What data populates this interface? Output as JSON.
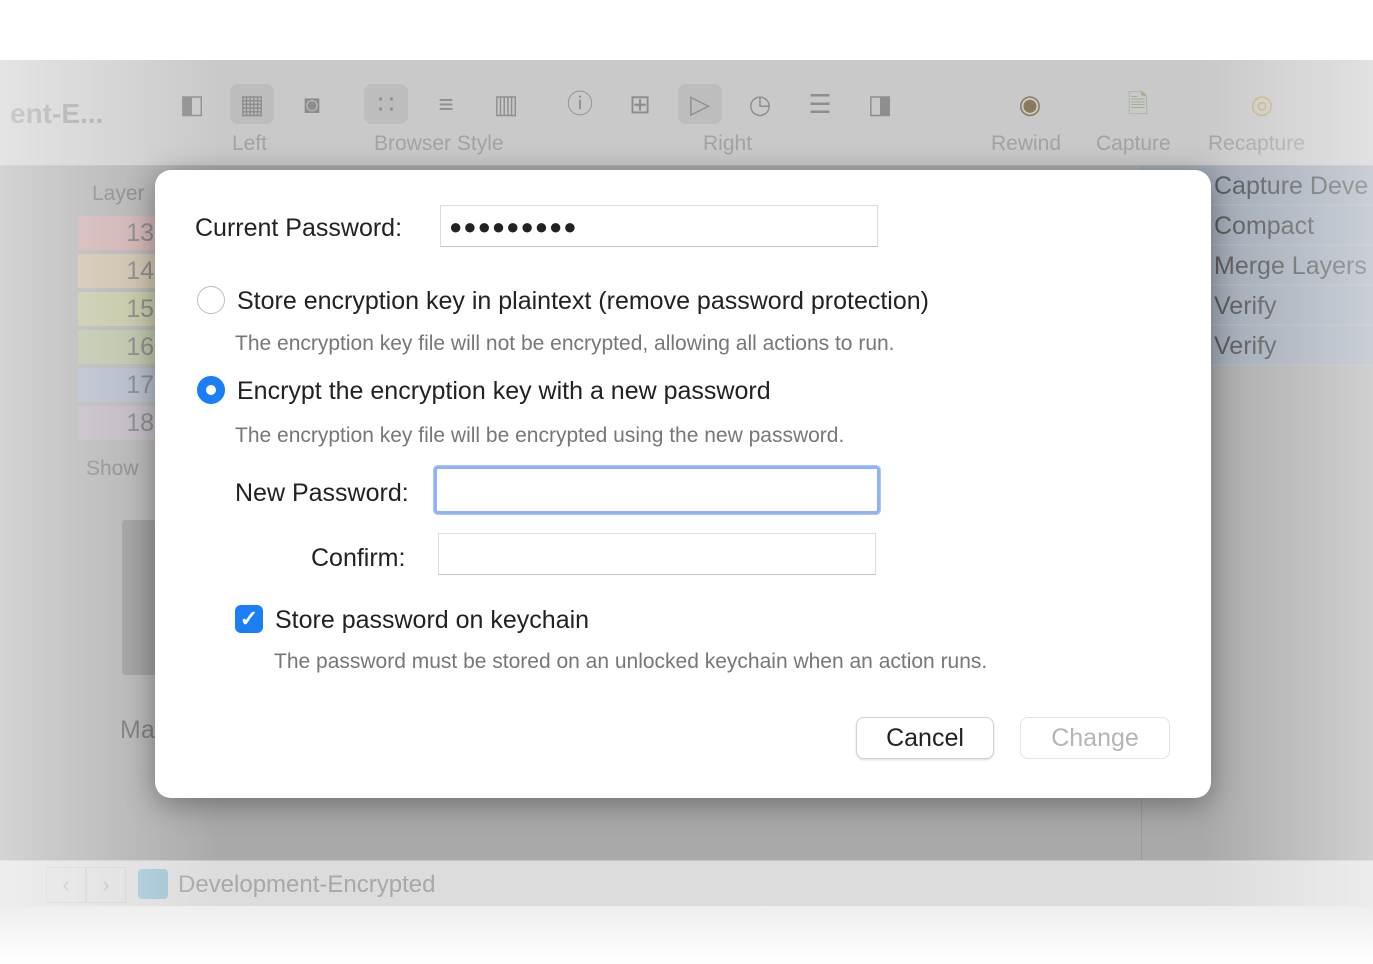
{
  "window": {
    "title": "ent-E...",
    "toolbar": {
      "groups": [
        {
          "label": "Left"
        },
        {
          "label": "Browser Style"
        },
        {
          "label": "Right"
        }
      ],
      "actions": [
        {
          "label": "Rewind",
          "icon": "rewind-icon"
        },
        {
          "label": "Capture",
          "icon": "capture-icon"
        },
        {
          "label": "Recapture",
          "icon": "recapture-icon"
        }
      ]
    },
    "layers": {
      "header": "Layer",
      "rows": [
        {
          "num": "13",
          "color": "#c9a7a7"
        },
        {
          "num": "14",
          "color": "#c7b8a0"
        },
        {
          "num": "15",
          "color": "#bcbf98"
        },
        {
          "num": "16",
          "color": "#b1bb9b"
        },
        {
          "num": "17",
          "color": "#a5b1c2"
        },
        {
          "num": "18",
          "color": "#b6adb8"
        }
      ]
    },
    "show_label": "Show",
    "device_label": "Ma",
    "actions_list": [
      "Capture Deve",
      "Compact",
      "Merge Layers",
      "Verify",
      "Verify"
    ],
    "status": {
      "document": "Development-Encrypted"
    }
  },
  "dialog": {
    "current_password_label": "Current Password:",
    "current_password_value": "●●●●●●●●●",
    "option_plaintext": {
      "label": "Store encryption key in plaintext (remove password protection)",
      "description": "The encryption key file will not be encrypted, allowing all actions to run.",
      "selected": false
    },
    "option_encrypt": {
      "label": "Encrypt the encryption key with a new password",
      "description": "The encryption key file will be encrypted using the new password.",
      "selected": true
    },
    "new_password_label": "New Password:",
    "new_password_value": "",
    "confirm_label": "Confirm:",
    "confirm_value": "",
    "keychain": {
      "label": "Store password on keychain",
      "checked": true,
      "description": "The password must be stored on an unlocked keychain when an action runs."
    },
    "cancel_label": "Cancel",
    "change_label": "Change",
    "accent": "#1a7ef5"
  }
}
